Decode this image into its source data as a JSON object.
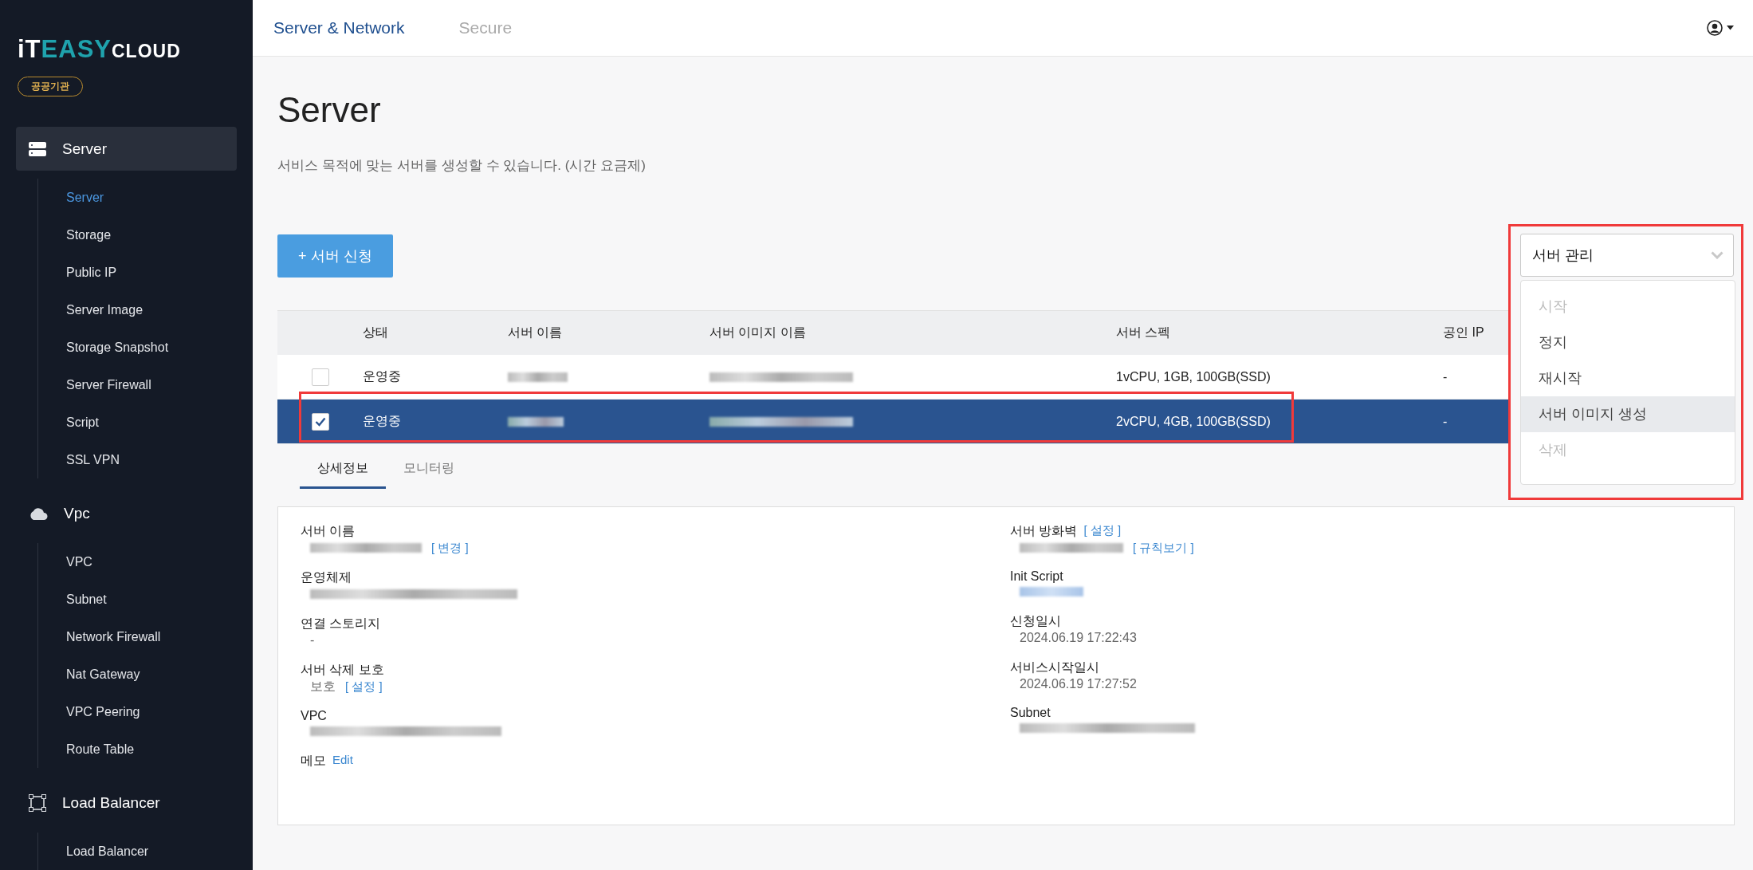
{
  "brand": {
    "logo_parts": [
      {
        "text": "iT",
        "color": "#ffffff"
      },
      {
        "text": "EASY",
        "color": "#1fa3ad"
      },
      {
        "text": "CLOUD",
        "color": "#ffffff"
      }
    ],
    "badge": "공공기관"
  },
  "sidebar": {
    "sections": [
      {
        "label": "Server",
        "selected": true,
        "children": [
          {
            "label": "Server",
            "selected": true
          },
          {
            "label": "Storage",
            "selected": false
          },
          {
            "label": "Public IP",
            "selected": false
          },
          {
            "label": "Server Image",
            "selected": false
          },
          {
            "label": "Storage Snapshot",
            "selected": false
          },
          {
            "label": "Server Firewall",
            "selected": false
          },
          {
            "label": "Script",
            "selected": false
          },
          {
            "label": "SSL VPN",
            "selected": false
          }
        ]
      },
      {
        "label": "Vpc",
        "selected": false,
        "children": [
          {
            "label": "VPC",
            "selected": false
          },
          {
            "label": "Subnet",
            "selected": false
          },
          {
            "label": "Network Firewall",
            "selected": false
          },
          {
            "label": "Nat Gateway",
            "selected": false
          },
          {
            "label": "VPC Peering",
            "selected": false
          },
          {
            "label": "Route Table",
            "selected": false
          }
        ]
      },
      {
        "label": "Load Balancer",
        "selected": false,
        "children": [
          {
            "label": "Load Balancer",
            "selected": false
          }
        ]
      }
    ]
  },
  "top_nav": [
    {
      "label": "Server & Network",
      "selected": true
    },
    {
      "label": "Secure",
      "selected": false
    }
  ],
  "page": {
    "title": "Server",
    "description": "서비스 목적에 맞는 서버를 생성할 수 있습니다. (시간 요금제)"
  },
  "create_button": {
    "icon": "+",
    "label": "서버 신청"
  },
  "table": {
    "columns": [
      "상태",
      "서버 이름",
      "서버 이미지 이름",
      "서버 스펙",
      "공인 IP"
    ],
    "rows": [
      {
        "checked": false,
        "selected": false,
        "highlighted": false,
        "status": "운영중",
        "spec": "1vCPU, 1GB, 100GB(SSD)",
        "public_ip": "-"
      },
      {
        "checked": true,
        "selected": true,
        "highlighted": true,
        "status": "운영중",
        "spec": "2vCPU, 4GB, 100GB(SSD)",
        "public_ip": "-"
      }
    ]
  },
  "detail_tabs": [
    {
      "label": "상세정보",
      "selected": true
    },
    {
      "label": "모니터링",
      "selected": false
    }
  ],
  "details": {
    "left": [
      {
        "kind": "stacked",
        "label": "서버 이름",
        "redacted": true,
        "value_links": [
          "[ 변경 ]"
        ]
      },
      {
        "kind": "stacked",
        "label": "운영체제",
        "redacted": true
      },
      {
        "kind": "stacked",
        "label": "연결 스토리지",
        "value": "-"
      },
      {
        "kind": "stacked",
        "label": "서버 삭제 보호",
        "value": "보호",
        "value_links": [
          "[ 설정 ]"
        ]
      },
      {
        "kind": "stacked",
        "label": "VPC",
        "redacted": true
      },
      {
        "kind": "inline",
        "label": "메모",
        "label_links": [
          "Edit"
        ]
      }
    ],
    "right": [
      {
        "kind": "stacked",
        "label": "서버 방화벽",
        "label_links": [
          "[ 설정 ]"
        ],
        "redacted": true,
        "value_links": [
          "[ 규칙보기 ]"
        ]
      },
      {
        "kind": "stacked",
        "label": "Init Script",
        "redacted": true
      },
      {
        "kind": "stacked",
        "label": "신청일시",
        "value": "2024.06.19 17:22:43"
      },
      {
        "kind": "stacked",
        "label": "서비스시작일시",
        "value": "2024.06.19 17:27:52"
      },
      {
        "kind": "stacked",
        "label": "Subnet",
        "redacted": true
      }
    ]
  },
  "server_menu": {
    "label": "서버 관리",
    "expanded": true,
    "highlighted": true,
    "items": [
      {
        "label": "시작",
        "disabled": true,
        "selected": false
      },
      {
        "label": "정지",
        "disabled": false,
        "selected": false
      },
      {
        "label": "재시작",
        "disabled": false,
        "selected": false
      },
      {
        "label": "서버 이미지 생성",
        "disabled": false,
        "selected": true
      },
      {
        "label": "삭제",
        "disabled": true,
        "selected": false
      }
    ]
  }
}
